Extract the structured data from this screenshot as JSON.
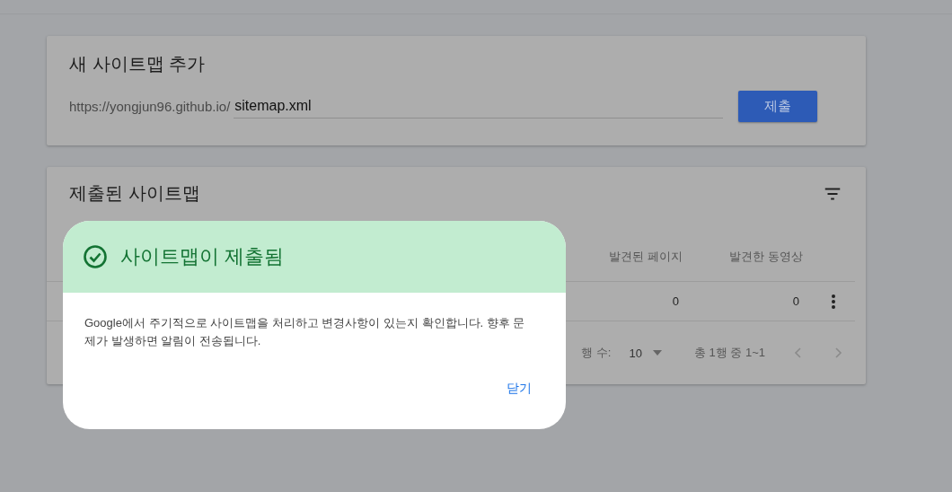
{
  "add_card": {
    "title": "새 사이트맵 추가",
    "url_prefix": "https://yongjun96.github.io/",
    "input_value": "sitemap.xml",
    "submit_label": "제출"
  },
  "submitted_card": {
    "title": "제출된 사이트맵",
    "columns": [
      "발견된 페이지",
      "발견한 동영상"
    ],
    "rows": [
      {
        "cells": [
          "0",
          "0"
        ]
      }
    ],
    "pagination": {
      "rows_label": "행 수:",
      "rows_per_page": "10",
      "range": "총 1행 중 1~1"
    }
  },
  "dialog": {
    "title": "사이트맵이 제출됨",
    "message": "Google에서 주기적으로 사이트맵을 처리하고 변경사항이 있는지 확인합니다. 향후 문제가 발생하면 알림이 전송됩니다.",
    "close_label": "닫기"
  }
}
